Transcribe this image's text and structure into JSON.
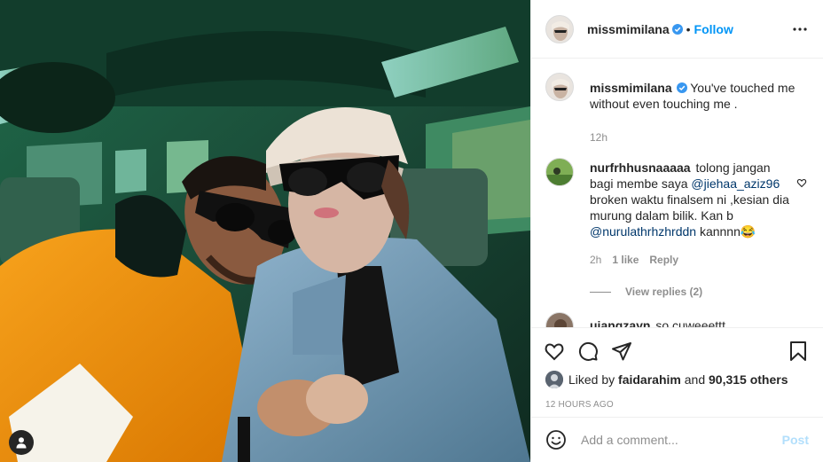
{
  "post": {
    "username": "missmimilana",
    "follow_label": "Follow",
    "dot": "•",
    "caption_text": "You've touched me without even touching me .",
    "caption_time": "12h"
  },
  "comments": [
    {
      "username": "nurfrhhusnaaaaa",
      "text_1": "tolong jangan bagi membe saya",
      "mention_1": "@jiehaa_aziz96",
      "text_2": "broken waktu finalsem ni ,kesian dia murung dalam bilik. Kan b",
      "mention_2": "@nurulathrhzhrddn",
      "text_3": "kannnn😂",
      "time": "2h",
      "likes": "1 like",
      "reply_label": "Reply",
      "view_replies": "View replies (2)"
    },
    {
      "username": "uiangzayn",
      "text": "so cuweeettt"
    }
  ],
  "likes": {
    "prefix": "Liked by",
    "liker": "faidarahim",
    "middle": "and",
    "count": "90,315 others"
  },
  "timestamp": "12 HOURS AGO",
  "add_comment": {
    "placeholder": "Add a comment...",
    "post_label": "Post"
  },
  "icons": {
    "verified": "verified-badge-icon",
    "more": "more-options-icon",
    "like": "heart-icon",
    "comment": "comment-icon",
    "share": "paper-plane-icon",
    "save": "bookmark-icon",
    "emoji": "emoji-icon",
    "tag": "user-tag-icon"
  },
  "colors": {
    "link_blue": "#0095f6",
    "mention": "#00376b",
    "secondary": "#8e8e8e",
    "post_disabled": "#b2dffc"
  }
}
